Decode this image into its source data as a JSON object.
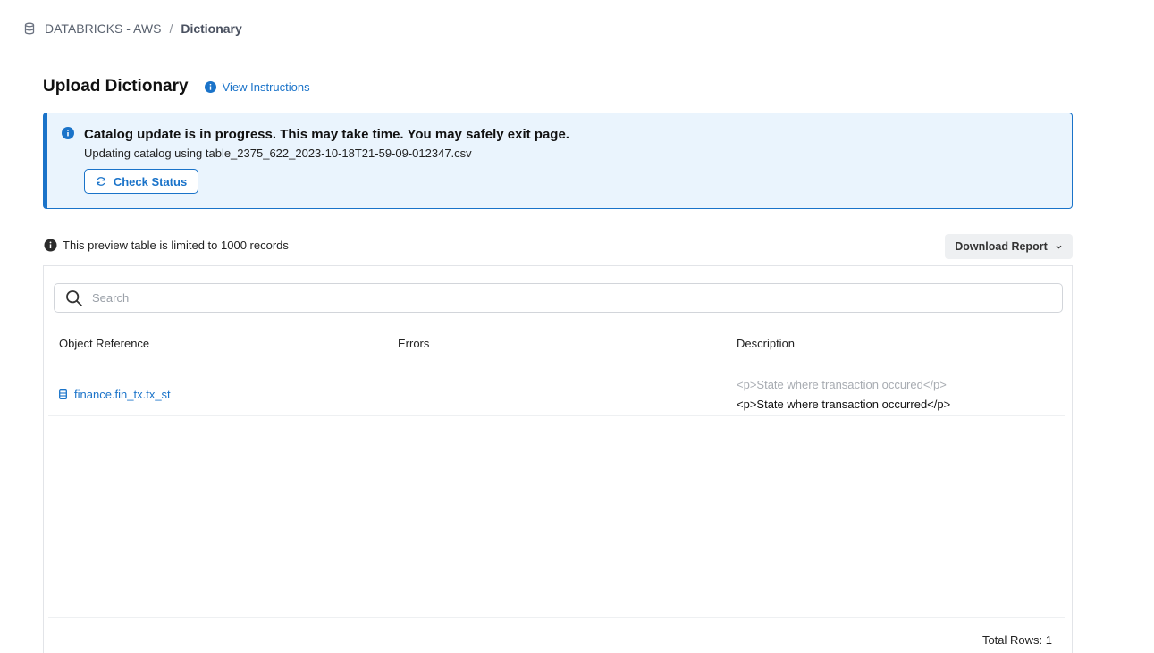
{
  "breadcrumb": {
    "icon": "database-icon",
    "root": "DATABRICKS - AWS",
    "separator": "/",
    "current": "Dictionary"
  },
  "page": {
    "title": "Upload Dictionary",
    "instructions_link": "View Instructions"
  },
  "alert": {
    "title": "Catalog update is in progress. This may take time. You may safely exit page.",
    "message": "Updating catalog using table_2375_622_2023-10-18T21-59-09-012347.csv",
    "button_label": "Check Status",
    "accent_color": "#1a73c9",
    "background_color": "#eaf4fd"
  },
  "preview": {
    "note": "This preview table is limited to 1000 records",
    "download_label": "Download Report"
  },
  "table": {
    "search_placeholder": "Search",
    "columns": [
      "Object Reference",
      "Errors",
      "Description"
    ],
    "rows": [
      {
        "object_reference": "finance.fin_tx.tx_st",
        "errors": "",
        "description_old": "<p>State where transaction occured</p>",
        "description_new": "<p>State where transaction occurred</p>"
      }
    ],
    "total_rows": "Total Rows: 1"
  }
}
